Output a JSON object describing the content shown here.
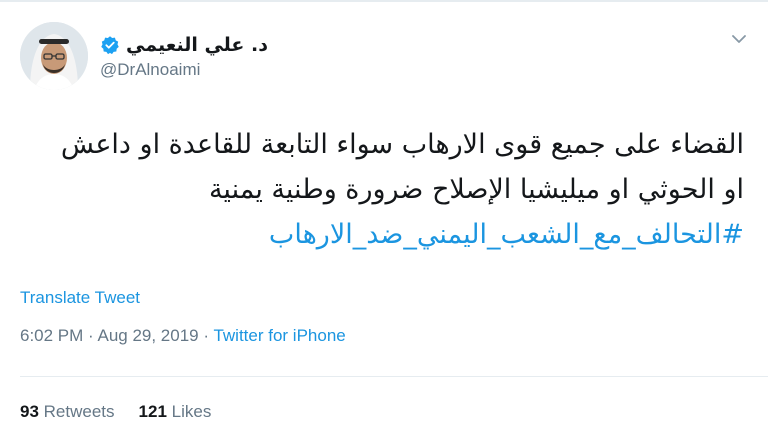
{
  "tweet": {
    "author": {
      "display_name": "د. علي النعيمي",
      "handle": "@DrAlnoaimi",
      "verified": true,
      "avatar": "avatar-photo"
    },
    "text_lines": [
      "القضاء على جميع قوى الارهاب سواء التابعة للقاعدة او داعش",
      "او الحوثي او ميليشيا الإصلاح ضرورة وطنية يمنية"
    ],
    "hashtag": "#التحالف_مع_الشعب_اليمني_ضد_الارهاب",
    "translate_label": "Translate Tweet",
    "time": "6:02 PM",
    "date": "Aug 29, 2019",
    "separator": " · ",
    "source": "Twitter for iPhone",
    "stats": {
      "retweets_count": "93",
      "retweets_label": "Retweets",
      "likes_count": "121",
      "likes_label": "Likes"
    }
  },
  "colors": {
    "link": "#1b95e0",
    "text": "#14171a",
    "muted": "#657786",
    "divider": "#e6ecf0"
  },
  "icons": {
    "menu": "chevron-down-icon",
    "verified": "verified-badge-icon"
  }
}
